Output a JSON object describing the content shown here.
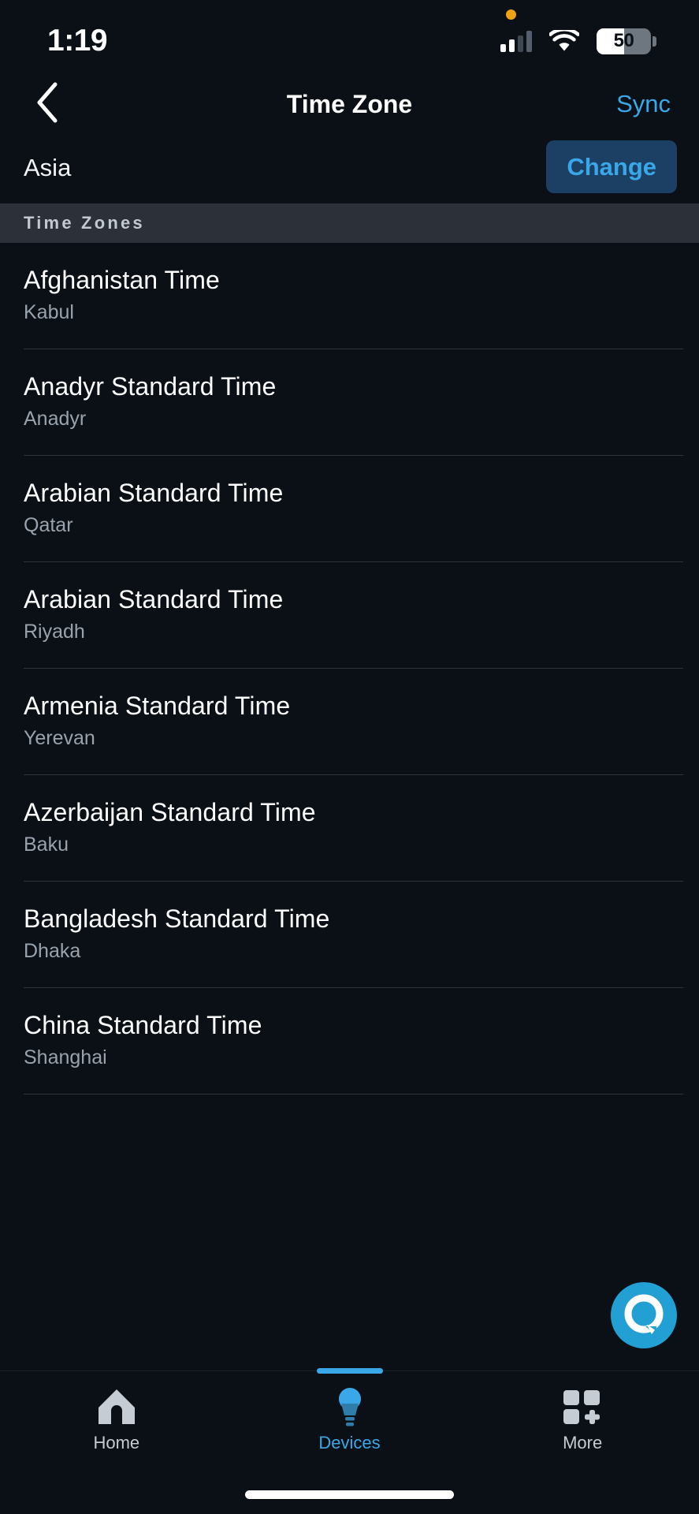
{
  "status_bar": {
    "time": "1:19",
    "privacy_indicator": "orange-dot",
    "signal_icon": "cellular-signal-icon",
    "signal_bars_filled": 2,
    "signal_bars_total": 4,
    "wifi_icon": "wifi-icon",
    "battery_percent": "50",
    "battery_level": 50
  },
  "nav": {
    "back_icon": "chevron-left-icon",
    "title": "Time Zone",
    "action_label": "Sync"
  },
  "region": {
    "name": "Asia",
    "change_label": "Change"
  },
  "section": {
    "header": "Time Zones"
  },
  "time_zones": [
    {
      "title": "Afghanistan Time",
      "city": "Kabul"
    },
    {
      "title": "Anadyr Standard Time",
      "city": "Anadyr"
    },
    {
      "title": "Arabian Standard Time",
      "city": "Qatar"
    },
    {
      "title": "Arabian Standard Time",
      "city": "Riyadh"
    },
    {
      "title": "Armenia Standard Time",
      "city": "Yerevan"
    },
    {
      "title": "Azerbaijan Standard Time",
      "city": "Baku"
    },
    {
      "title": "Bangladesh Standard Time",
      "city": "Dhaka"
    },
    {
      "title": "China Standard Time",
      "city": "Shanghai"
    }
  ],
  "alexa_button": {
    "icon": "alexa-logo-icon"
  },
  "tabs": [
    {
      "label": "Home",
      "icon": "home-icon",
      "active": false
    },
    {
      "label": "Devices",
      "icon": "lightbulb-icon",
      "active": true
    },
    {
      "label": "More",
      "icon": "grid-plus-icon",
      "active": false
    }
  ],
  "colors": {
    "background": "#0a1016",
    "accent_blue": "#3aa8e8",
    "section_header_bg": "#2b3039",
    "change_button_bg": "#1b4064",
    "alexa_cyan": "#22a0d4",
    "separator": "#2e343d",
    "subtitle_gray": "#9aa3ad",
    "privacy_orange": "#f0a215"
  }
}
